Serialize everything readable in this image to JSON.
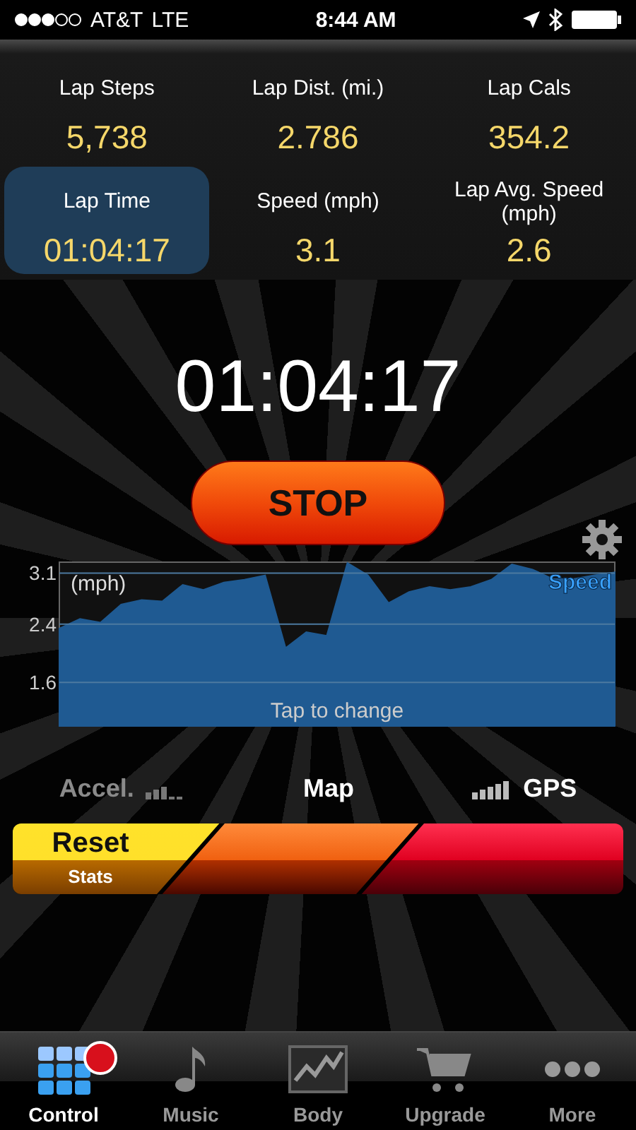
{
  "status_bar": {
    "carrier": "AT&T",
    "network": "LTE",
    "time": "8:44 AM"
  },
  "stats": [
    {
      "label": "Lap Steps",
      "value": "5,738",
      "selected": false
    },
    {
      "label": "Lap Dist. (mi.)",
      "value": "2.786",
      "selected": false
    },
    {
      "label": "Lap Cals",
      "value": "354.2",
      "selected": false
    },
    {
      "label": "Lap Time",
      "value": "01:04:17",
      "selected": true
    },
    {
      "label": "Speed (mph)",
      "value": "3.1",
      "selected": false
    },
    {
      "label": "Lap Avg. Speed (mph)",
      "value": "2.6",
      "selected": false
    }
  ],
  "timer": "01:04:17",
  "stop_button": "STOP",
  "chart": {
    "unit": "(mph)",
    "hint": "Tap to change",
    "chart_data": {
      "type": "area",
      "grid": true,
      "ylim": [
        1.0,
        3.25
      ],
      "yticks": [
        1.6,
        2.4,
        3.1
      ],
      "categories": [
        null,
        null,
        null,
        null,
        null,
        null,
        null,
        null,
        null,
        null,
        null,
        null,
        null,
        null,
        null,
        null,
        null,
        null,
        null,
        null,
        null,
        null,
        null,
        null,
        null,
        null,
        null,
        null
      ],
      "series": [
        {
          "name": "Speed",
          "color": "#1f5a92",
          "values": [
            2.34,
            2.47,
            2.42,
            2.67,
            2.73,
            2.71,
            2.94,
            2.87,
            2.97,
            3.01,
            3.07,
            2.07,
            2.29,
            2.24,
            3.24,
            3.07,
            2.69,
            2.84,
            2.91,
            2.87,
            2.91,
            3.01,
            3.22,
            3.15,
            3.02,
            3.02,
            3.07,
            3.11
          ]
        }
      ]
    }
  },
  "sensors": [
    {
      "kind": "accel",
      "label": "Accel.",
      "active": false
    },
    {
      "kind": "map",
      "label": "Map",
      "active": true
    },
    {
      "kind": "gps",
      "label": "GPS",
      "active": true
    }
  ],
  "reset_button": {
    "label": "Reset",
    "sublabel": "Stats"
  },
  "tabs": [
    {
      "label": "Control",
      "selected": true,
      "alert": true
    },
    {
      "label": "Music",
      "selected": false,
      "alert": false
    },
    {
      "label": "Body",
      "selected": false,
      "alert": false
    },
    {
      "label": "Upgrade",
      "selected": false,
      "alert": false
    },
    {
      "label": "More",
      "selected": false,
      "alert": false
    }
  ]
}
